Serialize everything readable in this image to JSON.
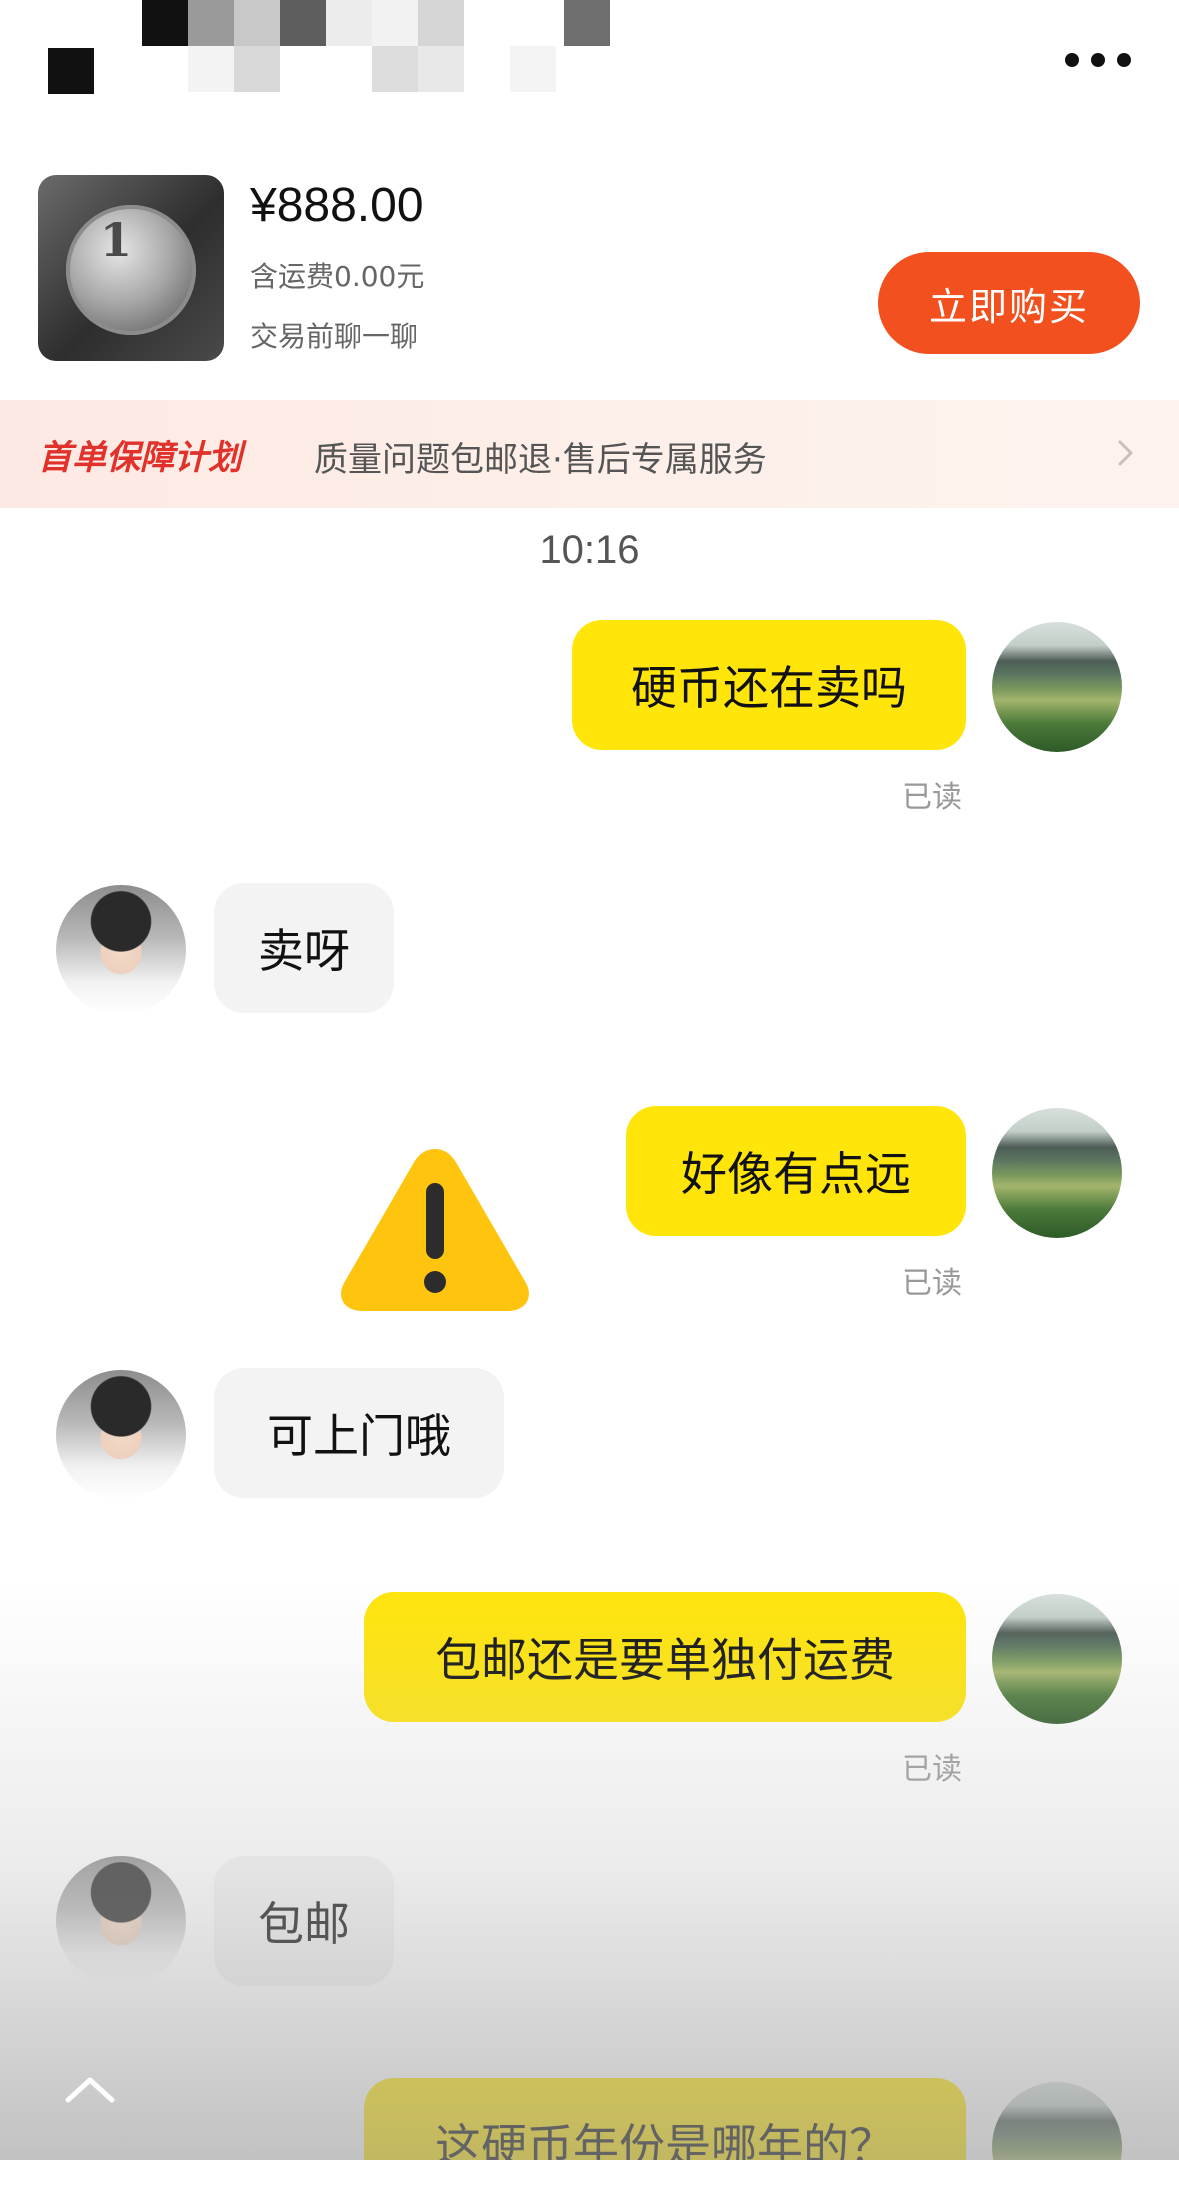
{
  "product": {
    "price": "¥888.00",
    "shipping": "含运费0.00元",
    "chat_hint": "交易前聊一聊",
    "buy_label": "立即购买",
    "image_icon": "coin-image"
  },
  "banner": {
    "title": "首单保障计划",
    "description": "质量问题包邮退·售后专属服务",
    "arrow_icon": "chevron-right-icon"
  },
  "chat": {
    "time": "10:16",
    "read_label": "已读",
    "messages": [
      {
        "from": "me",
        "text": "硬币还在卖吗",
        "read": "已读"
      },
      {
        "from": "them",
        "text": "卖呀"
      },
      {
        "from": "me",
        "text": "好像有点远",
        "read": "已读"
      },
      {
        "from": "them",
        "text": "可上门哦"
      },
      {
        "from": "me",
        "text": "包邮还是要单独付运费",
        "read": "已读"
      },
      {
        "from": "them",
        "text": "包邮"
      },
      {
        "from": "me",
        "text": "这硬币年份是哪年的？"
      }
    ]
  },
  "icons": {
    "more": "more-icon",
    "warning": "warning-icon",
    "scroll_up": "chevron-up-icon"
  },
  "colors": {
    "accent": "#f2501e",
    "my_bubble": "#ffe50a",
    "their_bubble": "#f3f3f3",
    "banner_title": "#e0312a"
  }
}
